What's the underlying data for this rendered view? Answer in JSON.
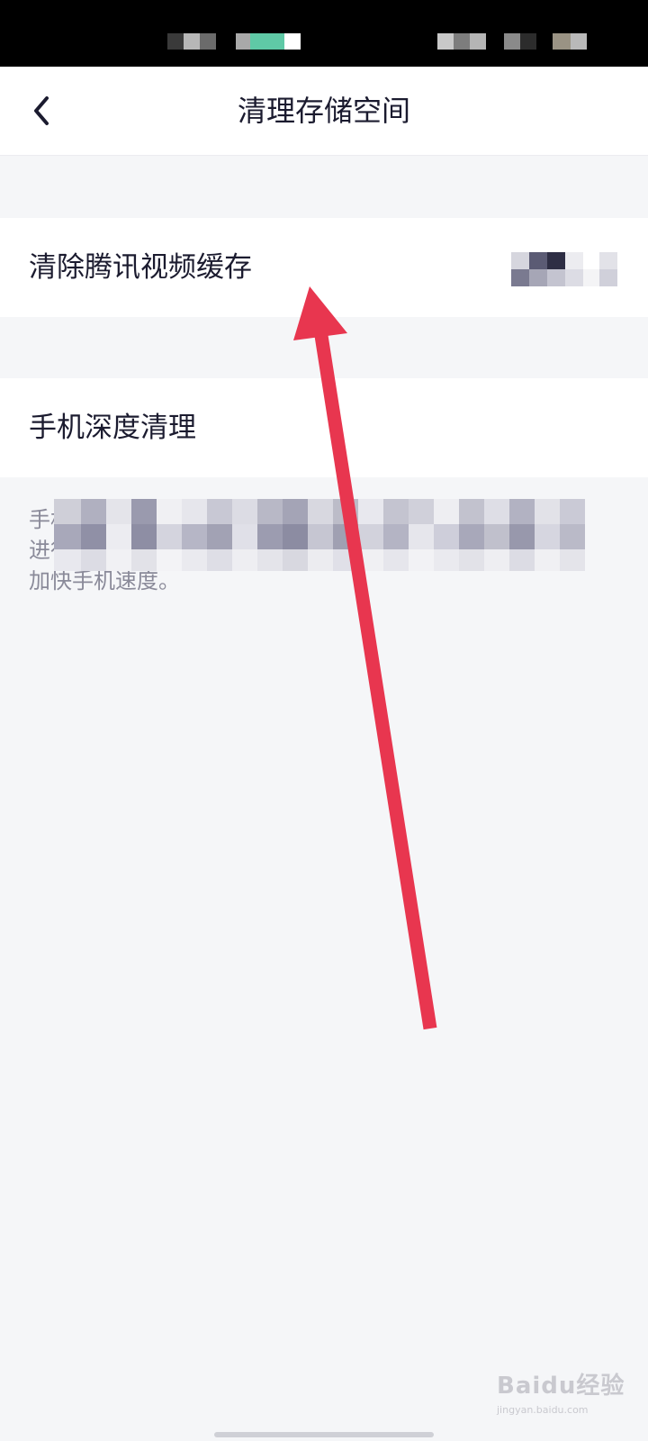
{
  "header": {
    "title": "清理存储空间",
    "back_icon": "chevron-left-icon"
  },
  "items": [
    {
      "label": "清除腾讯视频缓存",
      "value_redacted": true
    },
    {
      "label": "手机深度清理"
    }
  ],
  "description": {
    "lines": [
      "手机",
      "进行",
      "加快手机速度。"
    ],
    "redacted": true
  },
  "annotation": {
    "type": "arrow",
    "color": "#e8364f"
  },
  "watermark": {
    "brand": "Baidu经验",
    "url": "jingyan.baidu.com"
  },
  "colors": {
    "text_primary": "#1b1b2f",
    "text_secondary": "#8a8a99",
    "background": "#f5f6f8",
    "card": "#ffffff",
    "arrow": "#e8364f"
  }
}
